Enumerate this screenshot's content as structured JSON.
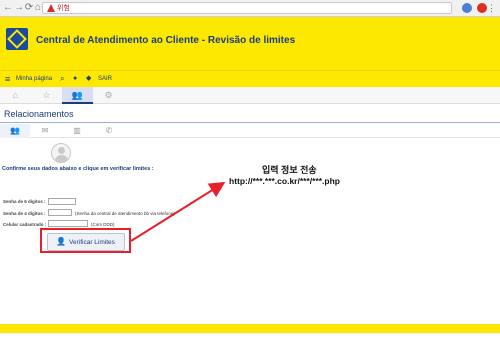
{
  "browser": {
    "back_icon": "back-arrow-icon",
    "forward_icon": "forward-arrow-icon",
    "reload_icon": "reload-icon",
    "home_icon": "home-icon",
    "security_warning": "위험",
    "menu_icon": "kebab-menu-icon"
  },
  "header": {
    "title": "Central de Atendimento ao Cliente - Revisão de limites",
    "brand_color": "#fce800",
    "logo_color": "#1a4b9c"
  },
  "toolbar": {
    "menu_label": "Minha página",
    "search_icon": "search-icon",
    "bell_icon": "bell-icon",
    "chat_icon": "chat-icon",
    "exit_label": "SAIR"
  },
  "tabs": [
    "home-icon",
    "star-icon",
    "people-icon",
    "gear-icon"
  ],
  "section": {
    "title": "Relacionamentos",
    "subtabs": [
      "people-icon",
      "envelope-icon",
      "building-icon",
      "phone-icon"
    ]
  },
  "form": {
    "confirm_text": "Confirme seus dados abaixo e clique em verificar limites :",
    "field1_label": "Senha de 6 dígitos :",
    "field1_value": "",
    "field2_label": "Senha de 4 dígitos :",
    "field2_value": "",
    "field2_hint": "(Senha da central de atendimento bb via telefone)",
    "field3_label": "Celular cadastrado :",
    "field3_value": "",
    "field3_hint": "(Com DDD)",
    "button_label": "Verificar Limites"
  },
  "annotation": {
    "title": "입력 정보 전송",
    "url": "http://***.***.co.kr/***/***.php",
    "highlight_color": "#e8202a"
  }
}
